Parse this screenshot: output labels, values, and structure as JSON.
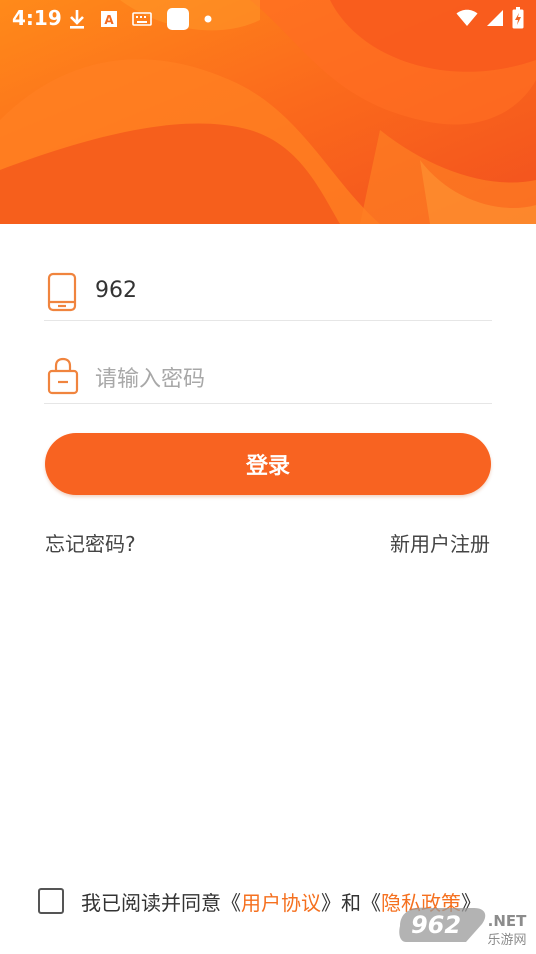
{
  "status_bar": {
    "time": "4:19",
    "left_icons": [
      "download-icon",
      "text-a-icon",
      "keyboard-icon",
      "square-app-icon",
      "dot-icon"
    ],
    "right_icons": [
      "wifi-icon",
      "signal-icon",
      "battery-charging-icon"
    ]
  },
  "colors": {
    "accent": "#f86321",
    "banner_light": "#ff7a1a",
    "banner_dark": "#e8401c",
    "link_orange": "#f5701f"
  },
  "login_form": {
    "phone_value": "962",
    "password_placeholder": "请输入密码",
    "login_button": "登录",
    "forgot_password": "忘记密码?",
    "register": "新用户注册"
  },
  "agreement": {
    "prefix": "我已阅读并同意",
    "open1": "《",
    "user_agreement": "用户协议",
    "close1": "》",
    "and": "和",
    "open2": "《",
    "privacy_policy": "隐私政策",
    "close2": "》"
  },
  "watermark": {
    "logo_number": "962",
    "logo_suffix": ".NET",
    "logo_subtitle": "乐游网"
  }
}
